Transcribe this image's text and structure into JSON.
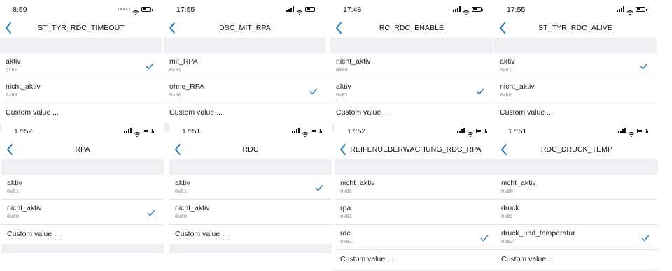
{
  "colors": {
    "accent": "#2a7ab8",
    "separator": "#efeff4"
  },
  "panels": [
    {
      "time": "8:59",
      "signal": "dots",
      "title": "ST_TYR_RDC_TIMEOUT",
      "options": [
        {
          "label": "aktiv",
          "code": "0x01",
          "selected": true
        },
        {
          "label": "nicht_aktiv",
          "code": "0x00",
          "selected": false
        }
      ],
      "custom": "Custom value ..."
    },
    {
      "time": "17:55",
      "signal": "bars",
      "title": "DSC_MIT_RPA",
      "options": [
        {
          "label": "mit_RPA",
          "code": "0x01",
          "selected": false
        },
        {
          "label": "ohne_RPA",
          "code": "0x00",
          "selected": true
        }
      ],
      "custom": "Custom value ..."
    },
    {
      "time": "17:48",
      "signal": "bars",
      "title": "RC_RDC_ENABLE",
      "options": [
        {
          "label": "nicht_aktiv",
          "code": "0x00",
          "selected": false
        },
        {
          "label": "aktiv",
          "code": "0x01",
          "selected": true
        }
      ],
      "custom": "Custom value ..."
    },
    {
      "time": "17:55",
      "signal": "bars",
      "title": "ST_TYR_RDC_ALIVE",
      "options": [
        {
          "label": "aktiv",
          "code": "0x01",
          "selected": true
        },
        {
          "label": "nicht_aktiv",
          "code": "0x00",
          "selected": false
        }
      ],
      "custom": "Custom value ..."
    },
    {
      "time": "17:52",
      "signal": "bars",
      "title": "RPA",
      "options": [
        {
          "label": "aktiv",
          "code": "0x01",
          "selected": false
        },
        {
          "label": "nicht_aktiv",
          "code": "0x00",
          "selected": true
        }
      ],
      "custom": "Custom value ..."
    },
    {
      "time": "17:51",
      "signal": "bars",
      "title": "RDC",
      "options": [
        {
          "label": "aktiv",
          "code": "0x01",
          "selected": true
        },
        {
          "label": "nicht_aktiv",
          "code": "0x00",
          "selected": false
        }
      ],
      "custom": "Custom value ..."
    },
    {
      "time": "17:52",
      "signal": "bars",
      "title": "REIFENUEBERWACHUNG_RDC_RPA",
      "options": [
        {
          "label": "nicht_aktiv",
          "code": "0x00",
          "selected": false
        },
        {
          "label": "rpa",
          "code": "0x01",
          "selected": false
        },
        {
          "label": "rdc",
          "code": "0x02",
          "selected": true
        }
      ],
      "custom": "Custom value ..."
    },
    {
      "time": "17:51",
      "signal": "bars",
      "title": "RDC_DRUCK_TEMP",
      "options": [
        {
          "label": "nicht_aktiv",
          "code": "0x00",
          "selected": false
        },
        {
          "label": "druck",
          "code": "0x01",
          "selected": false
        },
        {
          "label": "druck_und_temperatur",
          "code": "0x02",
          "selected": true
        }
      ],
      "custom": "Custom value ..."
    }
  ]
}
